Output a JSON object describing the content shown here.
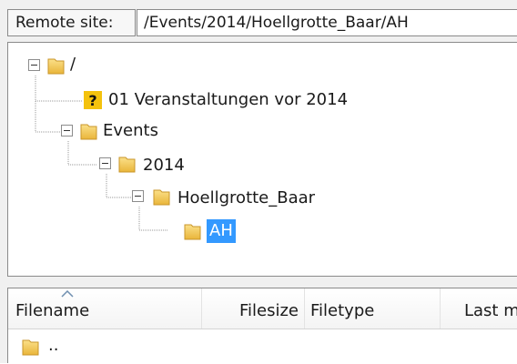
{
  "remote_site": {
    "label": "Remote site:",
    "path": "/Events/2014/Hoellgrotte_Baar/AH"
  },
  "tree": {
    "nodes": [
      {
        "label": "/",
        "icon": "folder-icon",
        "expander": "minus",
        "selected": false
      },
      {
        "label": "01 Veranstaltungen vor 2014",
        "icon": "unknown-question-icon",
        "expander": "none",
        "selected": false
      },
      {
        "label": "Events",
        "icon": "folder-icon",
        "expander": "minus",
        "selected": false
      },
      {
        "label": "2014",
        "icon": "folder-icon",
        "expander": "minus",
        "selected": false
      },
      {
        "label": "Hoellgrotte_Baar",
        "icon": "folder-icon",
        "expander": "minus",
        "selected": false
      },
      {
        "label": "AH",
        "icon": "folder-icon",
        "expander": "none",
        "selected": true
      }
    ]
  },
  "file_list": {
    "columns": [
      "Filename",
      "Filesize",
      "Filetype",
      "Last m"
    ],
    "sorted_column": "Filename",
    "rows": [
      {
        "name": "..",
        "icon": "folder-icon"
      }
    ]
  },
  "colors": {
    "selection": "#3399ff",
    "folder": "#f2c245",
    "question": "#f4c20d"
  }
}
